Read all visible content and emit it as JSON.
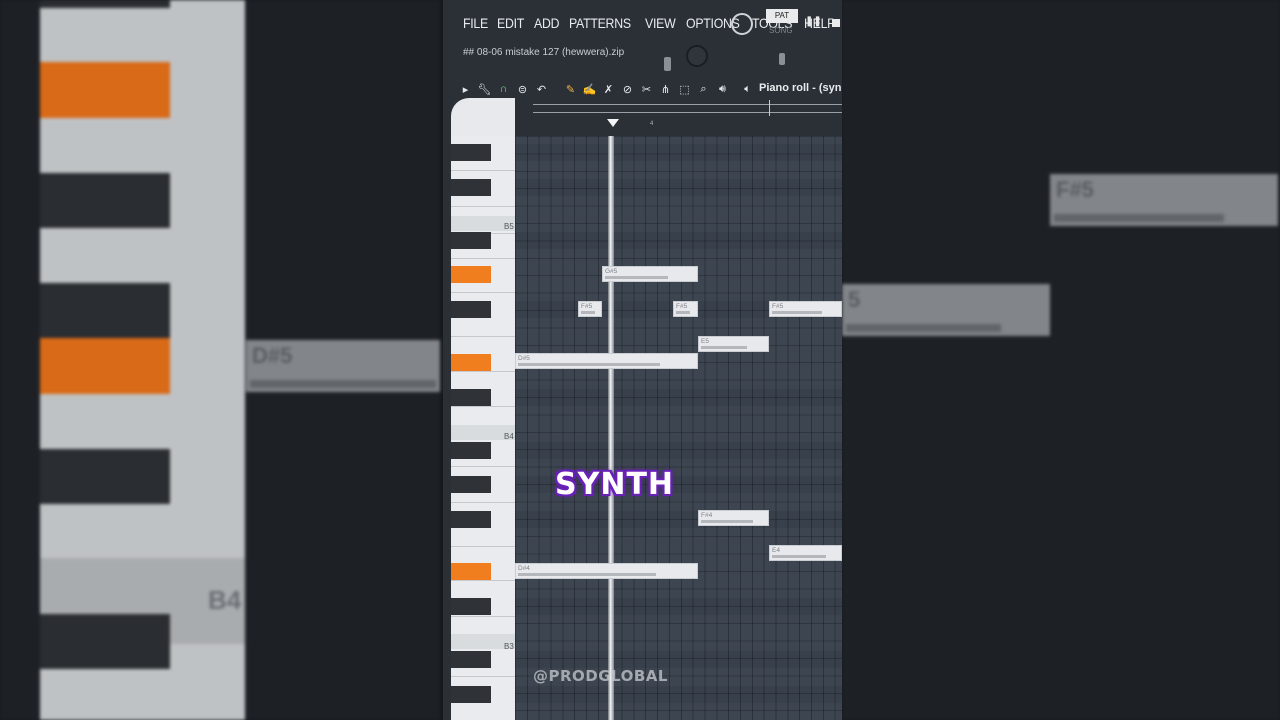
{
  "menu": {
    "items": [
      "FILE",
      "EDIT",
      "ADD",
      "PATTERNS",
      "VIEW",
      "OPTIONS",
      "TOOLS",
      "HELP"
    ]
  },
  "transport": {
    "pat_label": "PAT",
    "song_label": "SONG"
  },
  "hint_text": "## 08-06 mistake 127 (hewwera).zip",
  "piano_roll": {
    "title": "Piano roll - (syn",
    "ruler_bar": "4",
    "key_labels": {
      "b5": "B5",
      "b4": "B4",
      "b3": "B3"
    },
    "notes": [
      {
        "name": "G#5",
        "velocity": 0.7
      },
      {
        "name": "F#5",
        "velocity": 0.75
      },
      {
        "name": "F#5",
        "velocity": 0.75
      },
      {
        "name": "F#5",
        "velocity": 0.75
      },
      {
        "name": "E5",
        "velocity": 0.7
      },
      {
        "name": "D#5",
        "velocity": 0.8
      },
      {
        "name": "F#4",
        "velocity": 0.8
      },
      {
        "name": "E4",
        "velocity": 0.8
      },
      {
        "name": "D#4",
        "velocity": 0.78
      }
    ]
  },
  "overlay": {
    "caption": "SYNTH",
    "watermark": "@PRODGLOBAL"
  },
  "background": {
    "note_a": "F#5",
    "note_b": "D#5",
    "note_c": "5",
    "key_label": "B4"
  },
  "colors": {
    "accent_key": "#f07d1e",
    "caption_glow": "#6a22b8",
    "grid": "#3d4551"
  }
}
